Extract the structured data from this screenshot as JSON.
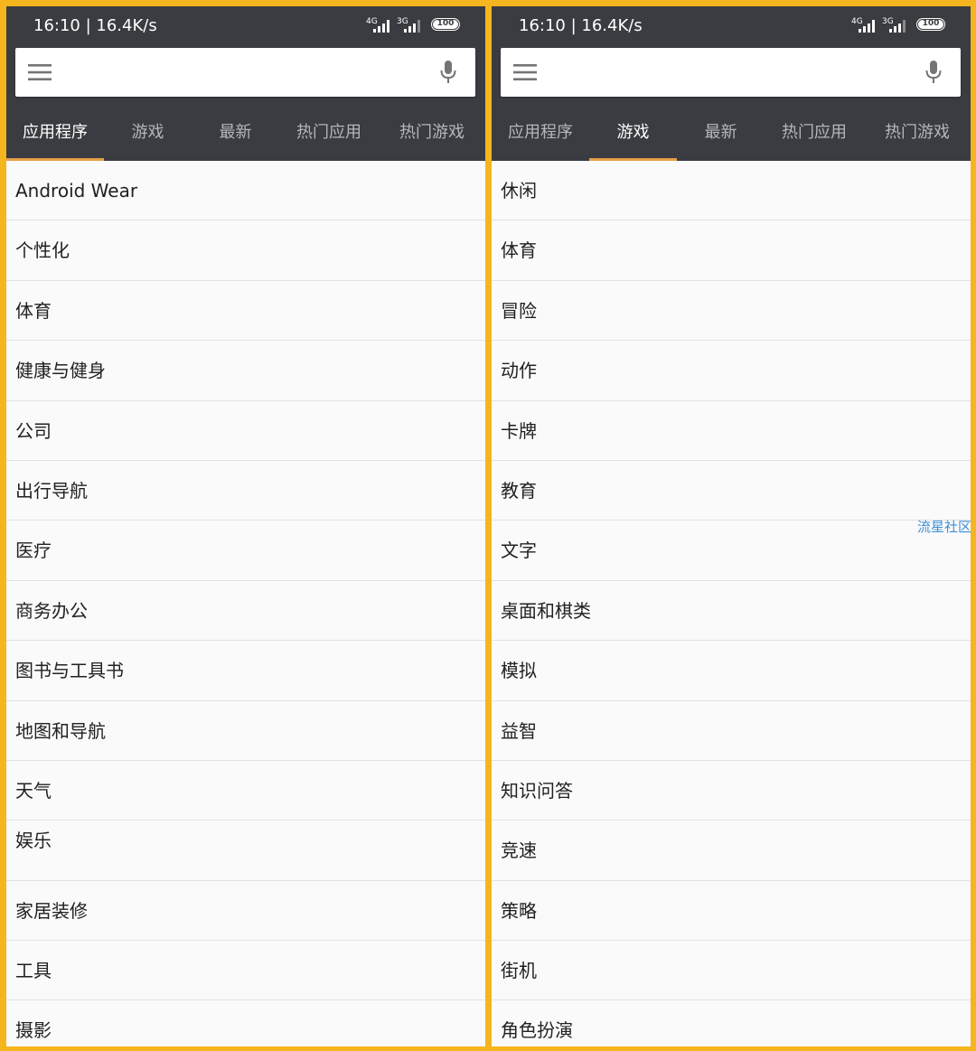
{
  "status": {
    "time": "16:10 | 16.4K/s",
    "sim1": "4G",
    "sim2": "3G",
    "battery": "100"
  },
  "tabs": [
    "应用程序",
    "游戏",
    "最新",
    "热门应用",
    "热门游戏"
  ],
  "colors": {
    "accent": "#e8a04a",
    "frame": "#f5b51f",
    "header": "#3a3c41"
  },
  "left_panel": {
    "active_tab": 0,
    "items": [
      "Android Wear",
      "个性化",
      "体育",
      "健康与健身",
      "公司",
      "出行导航",
      "医疗",
      "商务办公",
      "图书与工具书",
      "地图和导航",
      "天气",
      "娱乐",
      "家居装修",
      "工具",
      "摄影"
    ]
  },
  "right_panel": {
    "active_tab": 1,
    "items": [
      "休闲",
      "体育",
      "冒险",
      "动作",
      "卡牌",
      "教育",
      "文字",
      "桌面和棋类",
      "模拟",
      "益智",
      "知识问答",
      "竞速",
      "策略",
      "街机",
      "角色扮演"
    ]
  },
  "watermark": "流星社区"
}
